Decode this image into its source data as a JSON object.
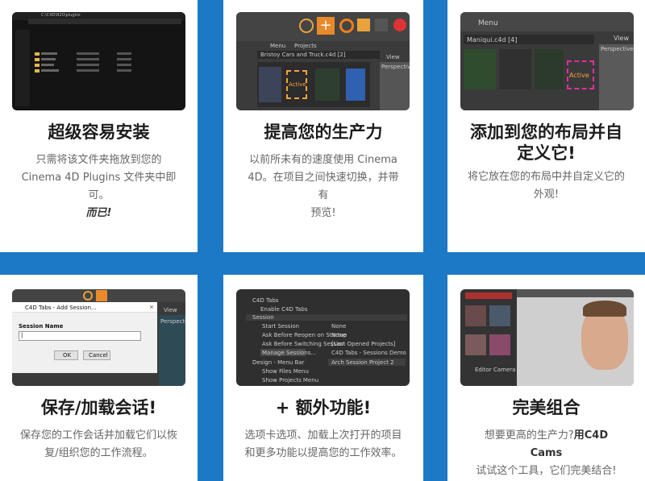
{
  "cards": [
    {
      "title": "超级容易安装",
      "desc_lines": [
        "只需将该文件夹拖放到您的",
        "Cinema 4D Plugins 文件夹中即",
        "可。"
      ],
      "emph": "而已!",
      "shot": {
        "path": "C:\\C4D\\R20\\plugins",
        "crumbs": [
          "Maxon",
          "MAXON",
          "CINEMA4D R20",
          "Plugins"
        ]
      }
    },
    {
      "title": "提高您的生产力",
      "desc_lines": [
        "以前所未有的速度使用 Cinema",
        "4D。在项目之间快速切换，并带有",
        "预览!"
      ],
      "shot": {
        "menu": "Menu",
        "projects": "Projects",
        "file": "Bristoy Cars and Truck.c4d [2]",
        "active": "Active",
        "view": "View",
        "persp": "Perspective"
      }
    },
    {
      "title_lines": [
        "添加到您的布局并自",
        "定义它!"
      ],
      "desc_lines": [
        "将它放在您的布局中并自定义它的",
        "外观!"
      ],
      "shot": {
        "menu": "Menu",
        "file": "Maniqui.c4d [4]",
        "active": "Active",
        "view": "View",
        "persp": "Perspective"
      }
    },
    {
      "title": "保存/加载会话!",
      "desc_lines": [
        "保存您的工作会话并加载它们以恢",
        "复/组织您的工作流程。"
      ],
      "shot": {
        "dialog_title": "C4D Tabs - Add Session...",
        "field_label": "Session Name",
        "field_value": "|",
        "ok": "OK",
        "cancel": "Cancel",
        "view": "View",
        "persp": "Perspective"
      }
    },
    {
      "title": "+ 额外功能!",
      "desc_lines": [
        "选项卡选项、加载上次打开的项目",
        "和更多功能以提高您的工作效率。"
      ],
      "shot": {
        "header": "C4D Tabs",
        "enable": "Enable C4D Tabs",
        "session": "Session",
        "rows": [
          {
            "label": "Start Session",
            "value": "None"
          },
          {
            "label": "Ask Before Reopen on Startup",
            "value": "None"
          },
          {
            "label": "Ask Before Switching Session",
            "value": "[Last Opened Projects]"
          },
          {
            "label": "Manage Sessions...",
            "value": "C4D Tabs - Sessions Demo"
          }
        ],
        "design": "Design - Menu Bar",
        "design_value": "Arch Session Project 2",
        "show_files": "Show Files Menu",
        "show_projects": "Show Projects Menu"
      }
    },
    {
      "title": "完美组合",
      "desc_lines": [
        "想要更高的生产力?"
      ],
      "desc_bold": "用C4D Cams",
      "desc_line2": "试试这个工具，它们完美结合!",
      "shot": {
        "label": "Editor Camera"
      }
    }
  ],
  "colors": {
    "band": "#1c79c6",
    "accent": "#f7a33a",
    "active": "#f7a33a",
    "magenta": "#e0309a"
  }
}
